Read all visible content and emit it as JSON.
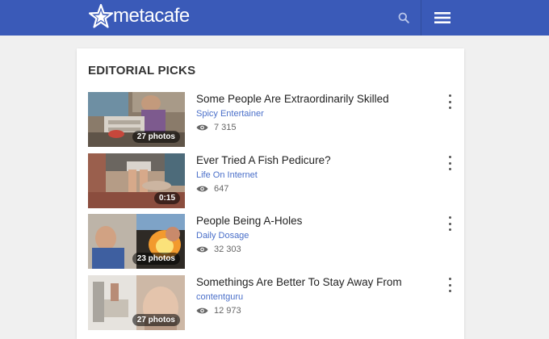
{
  "header": {
    "logo_text": "metacafe",
    "brand_color": "#3a5ab8",
    "search_icon": "search-icon",
    "menu_icon": "hamburger-menu-icon"
  },
  "section": {
    "title": "EDITORIAL PICKS"
  },
  "items": [
    {
      "title": "Some People Are Extraordinarily Skilled",
      "channel": "Spicy Entertainer",
      "views": "7 315",
      "badge": "27 photos"
    },
    {
      "title": "Ever Tried A Fish Pedicure?",
      "channel": "Life On Internet",
      "views": "647",
      "badge": "0:15"
    },
    {
      "title": "People Being A-Holes",
      "channel": "Daily Dosage",
      "views": "32 303",
      "badge": "23 photos"
    },
    {
      "title": "Somethings Are Better To Stay Away From",
      "channel": "contentguru",
      "views": "12 973",
      "badge": "27 photos"
    }
  ]
}
